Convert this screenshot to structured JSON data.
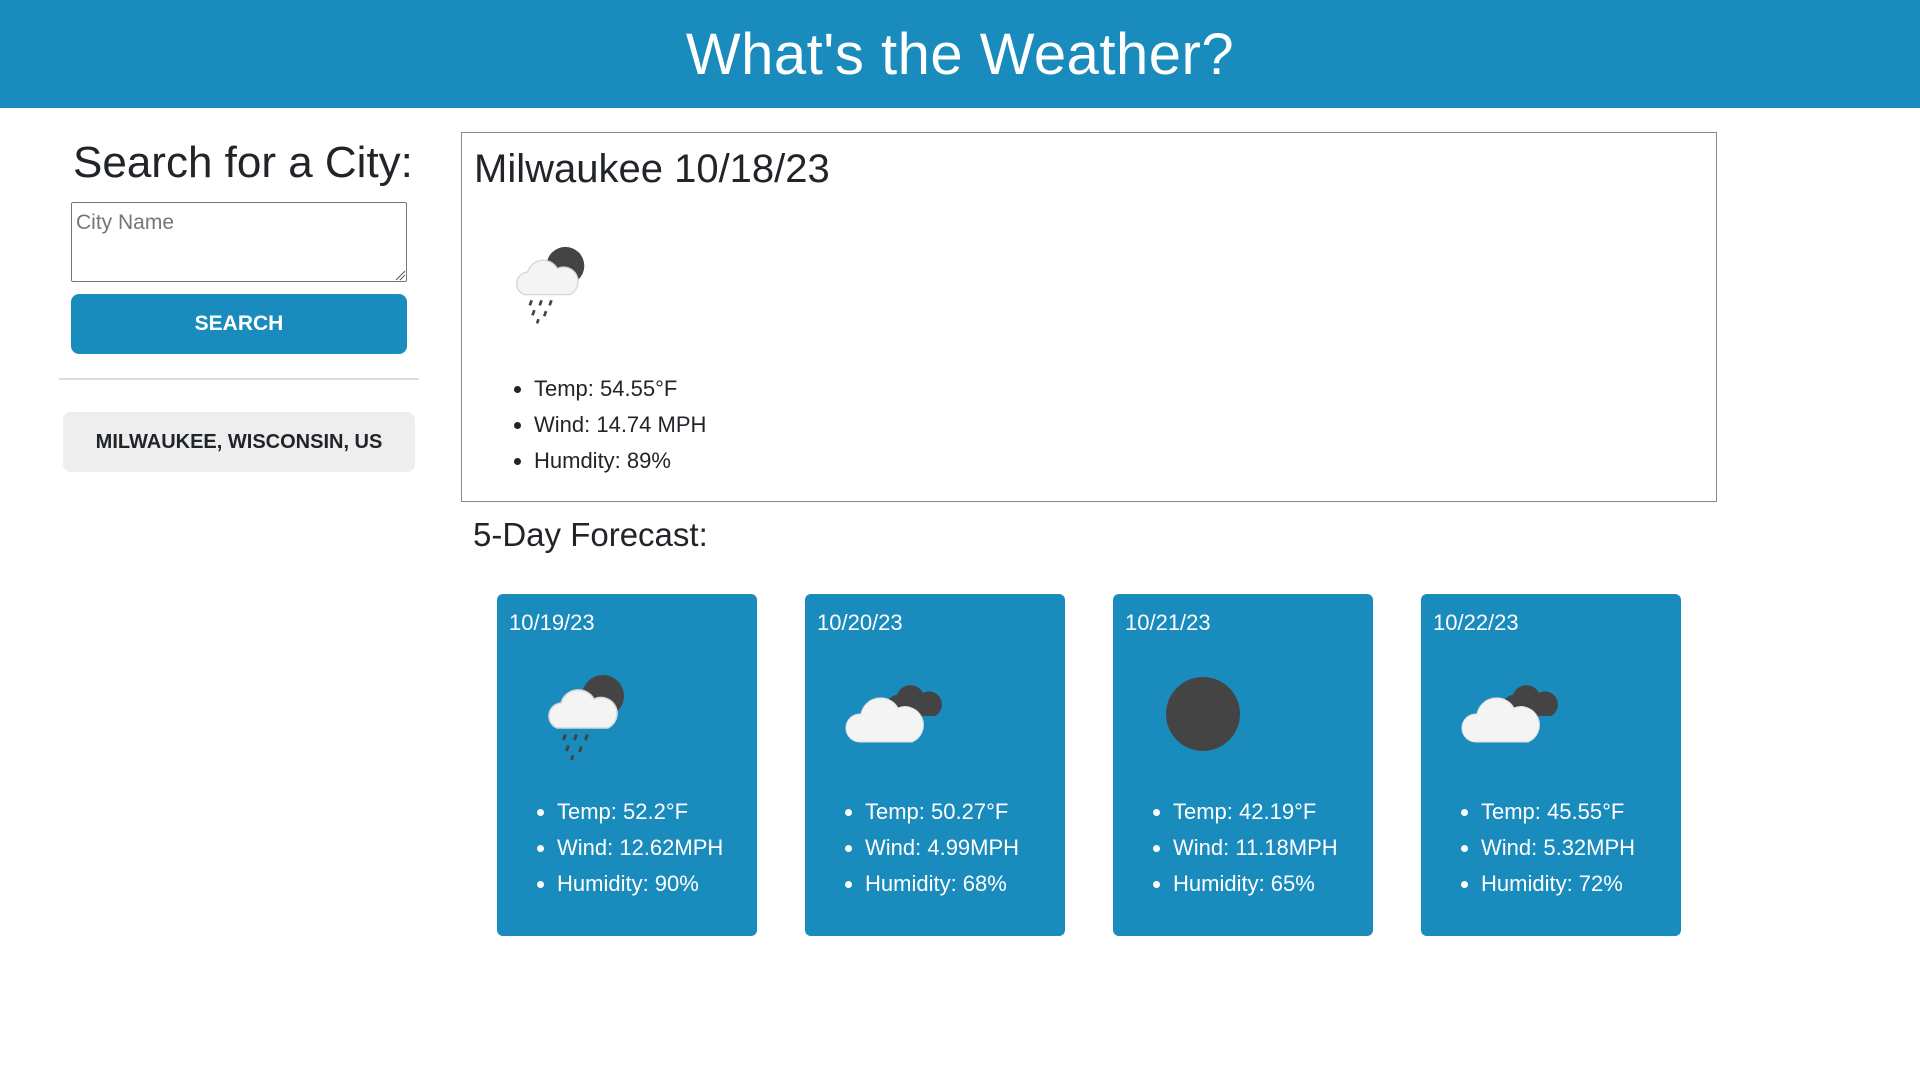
{
  "header": {
    "title": "What's the Weather?"
  },
  "sidebar": {
    "search_title": "Search for a City:",
    "input_placeholder": "City Name",
    "input_value": "",
    "search_label": "SEARCH",
    "history": [
      "MILWAUKEE, WISCONSIN, US"
    ]
  },
  "current": {
    "heading": "Milwaukee 10/18/23",
    "icon": "rain-night-cloud-icon",
    "temp": "Temp: 54.55°F",
    "wind": "Wind: 14.74 MPH",
    "humidity": "Humdity: 89%"
  },
  "forecast": {
    "title": "5-Day Forecast:",
    "days": [
      {
        "date": "10/19/23",
        "icon": "rain-night-cloud-icon",
        "temp": "Temp: 52.2°F",
        "wind": "Wind: 12.62MPH",
        "humidity": "Humidity: 90%"
      },
      {
        "date": "10/20/23",
        "icon": "broken-clouds-icon",
        "temp": "Temp: 50.27°F",
        "wind": "Wind: 4.99MPH",
        "humidity": "Humidity: 68%"
      },
      {
        "date": "10/21/23",
        "icon": "clear-night-icon",
        "temp": "Temp: 42.19°F",
        "wind": "Wind: 11.18MPH",
        "humidity": "Humidity: 65%"
      },
      {
        "date": "10/22/23",
        "icon": "broken-clouds-icon",
        "temp": "Temp: 45.55°F",
        "wind": "Wind: 5.32MPH",
        "humidity": "Humidity: 72%"
      }
    ]
  },
  "colors": {
    "accent": "#1a8bbd",
    "history_button": "#eeeeee",
    "icon_dark": "#444444",
    "cloud": "#f2f2f2"
  }
}
